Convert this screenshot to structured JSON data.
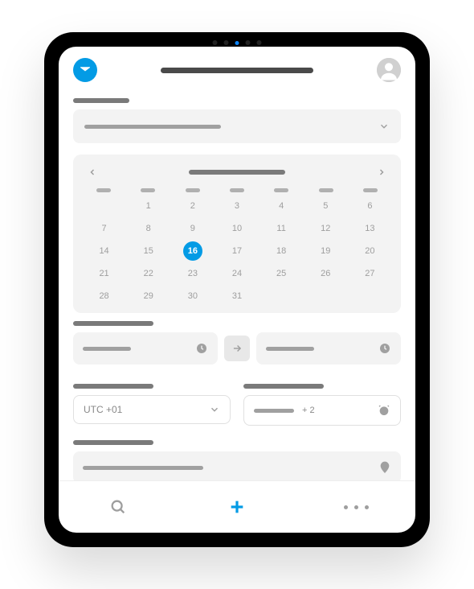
{
  "colors": {
    "accent": "#039be5",
    "muted": "#9e9e9e"
  },
  "calendar": {
    "selected_day": 16,
    "weeks": [
      [
        "",
        "1",
        "2",
        "3",
        "4",
        "5",
        "6"
      ],
      [
        "7",
        "8",
        "9",
        "10",
        "11",
        "12",
        "13"
      ],
      [
        "14",
        "15",
        "16",
        "17",
        "18",
        "19",
        "20"
      ],
      [
        "21",
        "22",
        "23",
        "24",
        "25",
        "26",
        "27"
      ],
      [
        "28",
        "29",
        "30",
        "31",
        "",
        "",
        ""
      ]
    ]
  },
  "timezone": {
    "value": "UTC +01"
  },
  "reminder": {
    "extra_count": "+ 2"
  }
}
